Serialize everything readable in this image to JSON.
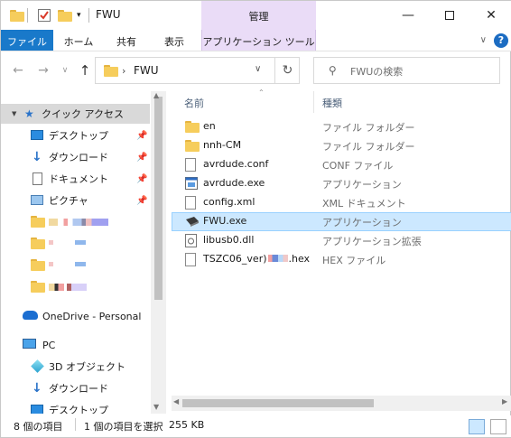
{
  "window": {
    "title": "FWU",
    "contextual_tab": "管理"
  },
  "ribbon": {
    "tabs": [
      "ファイル",
      "ホーム",
      "共有",
      "表示",
      "アプリケーション ツール"
    ],
    "help_label": "?"
  },
  "address": {
    "path": "FWU",
    "separator": "›"
  },
  "search": {
    "placeholder": "FWUの検索"
  },
  "nav": {
    "quick_access": "クイック アクセス",
    "pinned": [
      "デスクトップ",
      "ダウンロード",
      "ドキュメント",
      "ピクチャ"
    ],
    "onedrive": "OneDrive - Personal",
    "pc": "PC",
    "pc_items": [
      "3D オブジェクト",
      "ダウンロード",
      "デスクトップ"
    ]
  },
  "columns": {
    "name": "名前",
    "type": "種類"
  },
  "files": [
    {
      "name": "en",
      "type": "ファイル フォルダー",
      "icon": "folder-icon"
    },
    {
      "name": "nnh-CM",
      "type": "ファイル フォルダー",
      "icon": "folder-icon"
    },
    {
      "name": "avrdude.conf",
      "type": "CONF ファイル",
      "icon": "document-icon"
    },
    {
      "name": "avrdude.exe",
      "type": "アプリケーション",
      "icon": "application-icon"
    },
    {
      "name": "config.xml",
      "type": "XML ドキュメント",
      "icon": "document-icon"
    },
    {
      "name": "FWU.exe",
      "type": "アプリケーション",
      "icon": "usb-device-icon"
    },
    {
      "name": "libusb0.dll",
      "type": "アプリケーション拡張",
      "icon": "dll-icon"
    },
    {
      "name": "TSZC06_ver)",
      "name_suffix": ".hex",
      "type": "HEX ファイル",
      "icon": "document-icon"
    }
  ],
  "status": {
    "item_count": "8 個の項目",
    "selection": "1 個の項目を選択",
    "size": "255 KB"
  },
  "colors": {
    "accent": "#1979ca",
    "selection": "#cce8ff",
    "manage_tab": "#eadcf7"
  }
}
